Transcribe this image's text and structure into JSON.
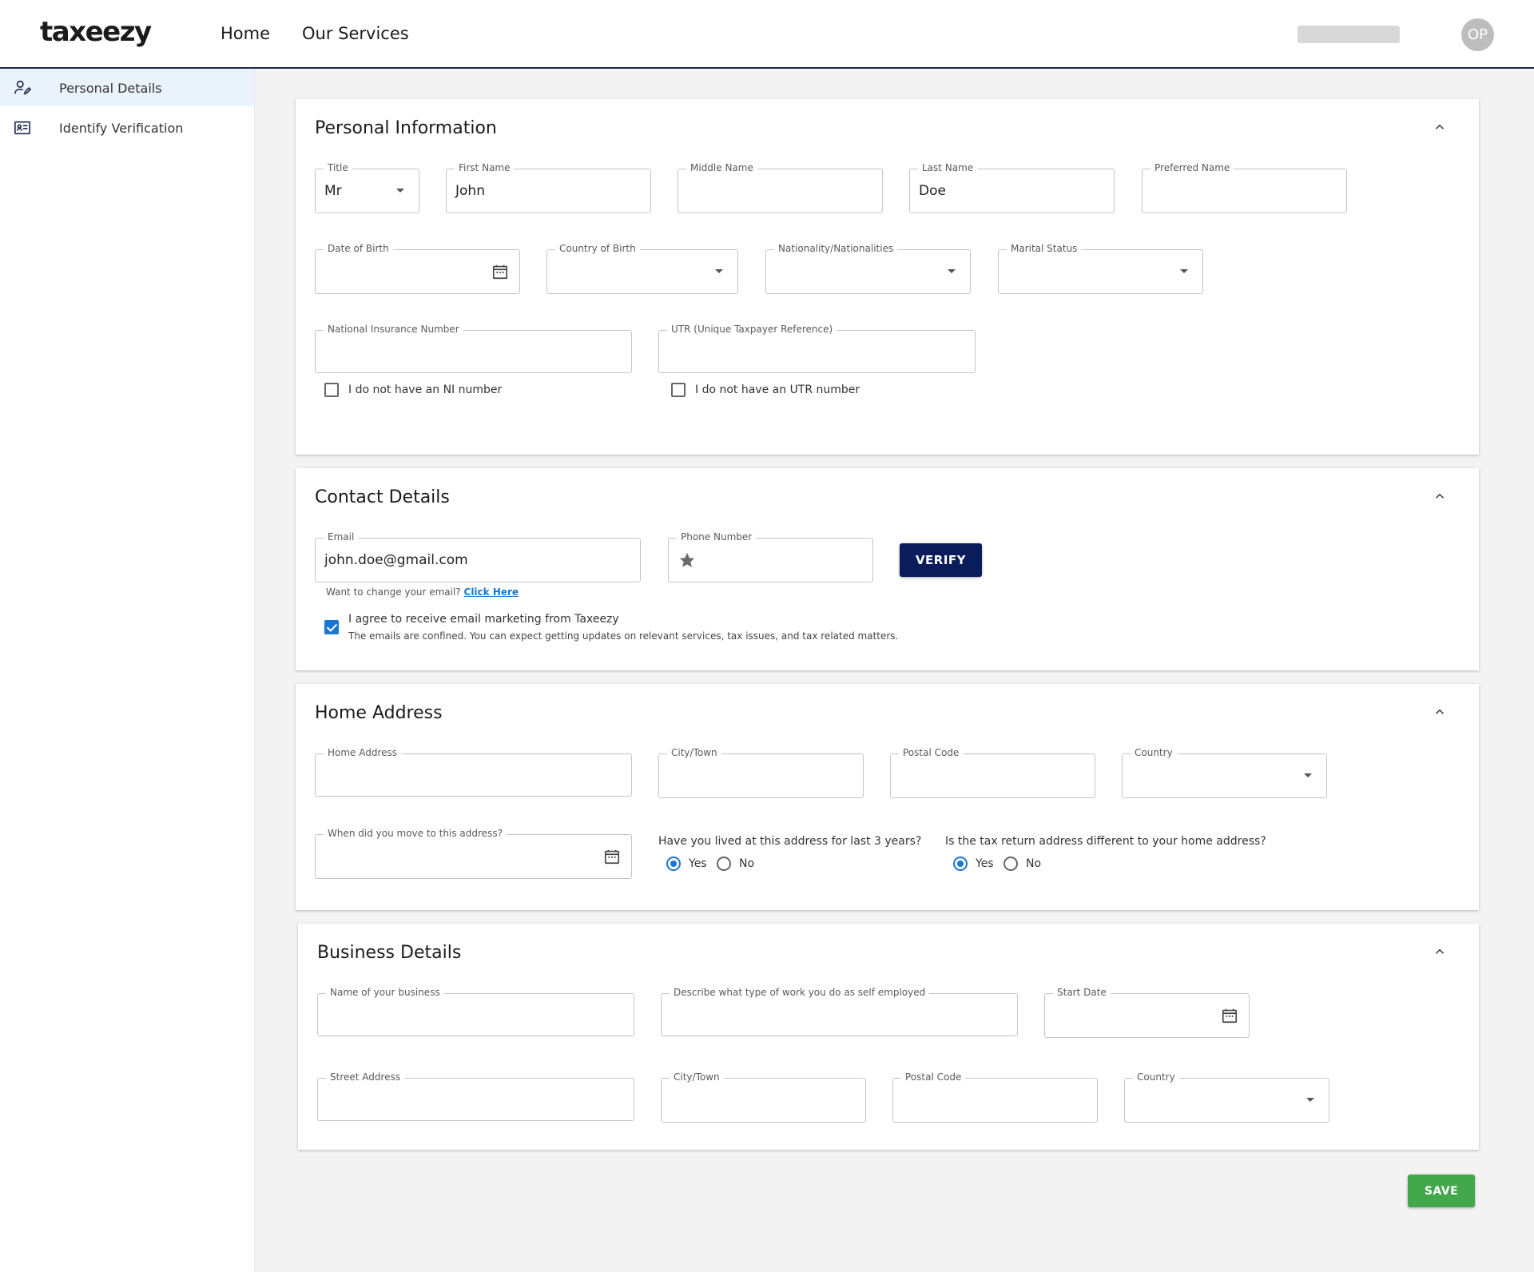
{
  "header": {
    "logo": "taxeezy",
    "nav": [
      {
        "label": "Home"
      },
      {
        "label": "Our Services"
      }
    ],
    "avatar_initials": "OP"
  },
  "sidebar": {
    "items": [
      {
        "label": "Personal Details",
        "icon": "user-edit-icon",
        "active": true
      },
      {
        "label": "Identify Verification",
        "icon": "id-card-icon",
        "active": false
      }
    ]
  },
  "personal": {
    "title": "Personal Information",
    "title_field": {
      "label": "Title",
      "value": "Mr"
    },
    "first_name": {
      "label": "First Name",
      "value": "John"
    },
    "middle_name": {
      "label": "Middle Name",
      "value": ""
    },
    "last_name": {
      "label": "Last Name",
      "value": "Doe"
    },
    "preferred_name": {
      "label": "Preferred Name",
      "value": ""
    },
    "dob": {
      "label": "Date of Birth",
      "value": ""
    },
    "country_of_birth": {
      "label": "Country of Birth",
      "value": ""
    },
    "nationality": {
      "label": "Nationality/Nationalities",
      "value": ""
    },
    "marital_status": {
      "label": "Marital Status",
      "value": ""
    },
    "ni_number": {
      "label": "National Insurance Number",
      "value": ""
    },
    "utr": {
      "label": "UTR (Unique Taxpayer Reference)",
      "value": ""
    },
    "no_ni_label": "I do not have an NI number",
    "no_utr_label": "I do not have an UTR number"
  },
  "contact": {
    "title": "Contact Details",
    "email": {
      "label": "Email",
      "value": "john.doe@gmail.com"
    },
    "phone": {
      "label": "Phone Number",
      "value": ""
    },
    "verify_label": "VERIFY",
    "change_email_text": "Want to change your email?",
    "change_email_link": "Click Here",
    "marketing_label": "I agree to receive email marketing from Taxeezy",
    "marketing_note": "The emails are confined. You can expect getting updates on relevant services, tax issues, and tax related matters."
  },
  "home_address": {
    "title": "Home Address",
    "address": {
      "label": "Home Address",
      "value": ""
    },
    "city": {
      "label": "City/Town",
      "value": ""
    },
    "postal_code": {
      "label": "Postal Code",
      "value": ""
    },
    "country": {
      "label": "Country",
      "value": ""
    },
    "move_date": {
      "label": "When did you move to this address?",
      "value": ""
    },
    "lived_q": "Have you lived at this address for last 3 years?",
    "tax_addr_q": "Is the tax return address different to your home address?",
    "yes_label": "Yes",
    "no_label": "No"
  },
  "business": {
    "title": "Business Details",
    "name": {
      "label": "Name of your business",
      "value": ""
    },
    "work_type": {
      "label": "Describe what type of work you do as self employed",
      "value": ""
    },
    "start_date": {
      "label": "Start Date",
      "value": ""
    },
    "street": {
      "label": "Street Address",
      "value": ""
    },
    "city": {
      "label": "City/Town",
      "value": ""
    },
    "postal_code": {
      "label": "Postal Code",
      "value": ""
    },
    "country": {
      "label": "Country",
      "value": ""
    }
  },
  "save_label": "SAVE",
  "colors": {
    "primary": "#0b1c5a",
    "accent": "#1976d2",
    "save": "#43a74b"
  }
}
